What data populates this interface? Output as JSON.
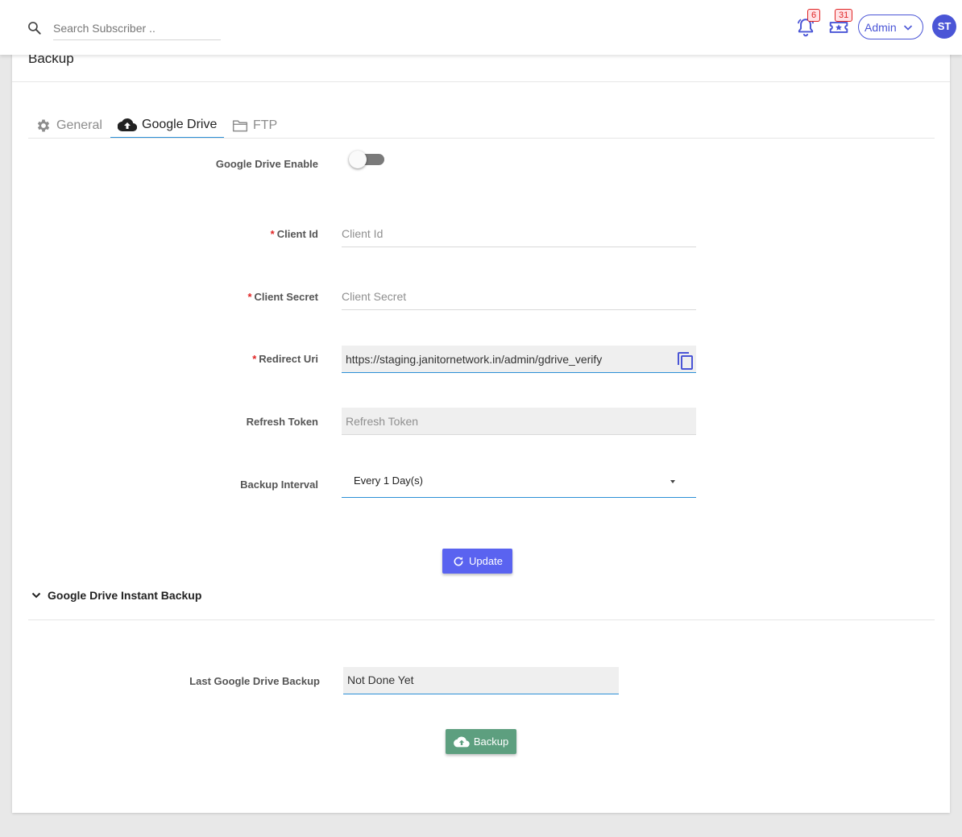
{
  "search": {
    "placeholder": "Search Subscriber .."
  },
  "header": {
    "notifications_count": "6",
    "tickets_count": "31",
    "user_menu_label": "Admin",
    "avatar_initials": "ST"
  },
  "page": {
    "title": "Backup"
  },
  "tabs": [
    {
      "label": "General",
      "icon": "gear-icon",
      "active": false
    },
    {
      "label": "Google Drive",
      "icon": "cloud-upload-icon",
      "active": true
    },
    {
      "label": "FTP",
      "icon": "folder-icon",
      "active": false
    }
  ],
  "form": {
    "enable_label": "Google Drive Enable",
    "enable_value": false,
    "client_id": {
      "label": "Client Id",
      "placeholder": "Client Id",
      "value": ""
    },
    "client_secret": {
      "label": "Client Secret",
      "placeholder": "Client Secret",
      "value": ""
    },
    "redirect_uri": {
      "label": "Redirect Uri",
      "value": "https://staging.janitornetwork.in/admin/gdrive_verify"
    },
    "refresh_token": {
      "label": "Refresh Token",
      "placeholder": "Refresh Token",
      "value": ""
    },
    "backup_interval": {
      "label": "Backup Interval",
      "value": "Every 1 Day(s)"
    },
    "required_marker": "*",
    "update_label": "Update"
  },
  "instant_backup": {
    "title": "Google Drive Instant Backup",
    "last_backup_label": "Last Google Drive Backup",
    "last_backup_value": "Not Done Yet",
    "backup_label": "Backup"
  },
  "colors": {
    "accent": "#4a55d6",
    "primary_button": "#5a63f0",
    "backup_button": "#5d9f7f",
    "tab_underline": "#2b8fd6",
    "required": "#e02424"
  }
}
